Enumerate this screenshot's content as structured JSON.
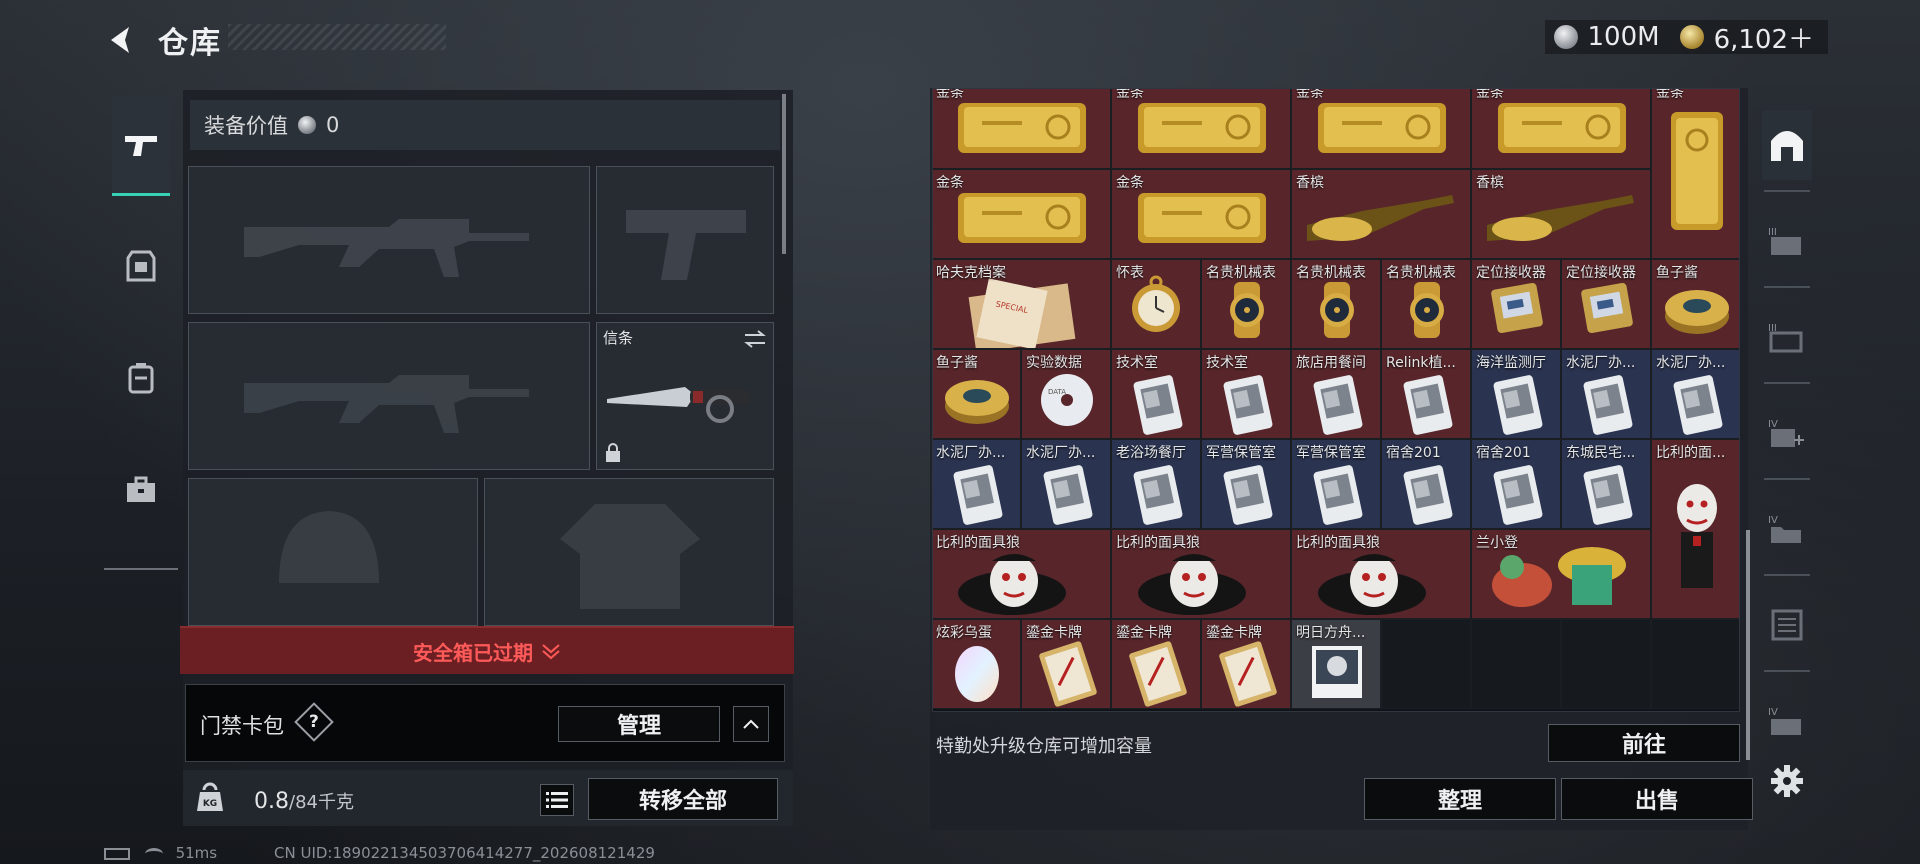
{
  "header": {
    "title": "仓库",
    "back_icon": "back-arrow-icon"
  },
  "currency": [
    {
      "icon": "silver-coin-icon",
      "value": "100M"
    },
    {
      "icon": "gold-coin-icon",
      "value": "6,102＋"
    }
  ],
  "left_nav": [
    {
      "name": "weapon",
      "icon": "pistol-icon",
      "active": true
    },
    {
      "name": "armor",
      "icon": "armor-icon"
    },
    {
      "name": "backpack",
      "icon": "backpack-icon"
    },
    {
      "name": "case",
      "icon": "briefcase-icon"
    }
  ],
  "equipment": {
    "value_label": "装备价值",
    "value": "0",
    "knife_slot_label": "信条",
    "slots": [
      "primary-rifle",
      "pistol",
      "secondary-rifle",
      "melee",
      "helmet",
      "armor-vest"
    ]
  },
  "safe_box": {
    "status": "安全箱已过期"
  },
  "card_pack": {
    "label": "门禁卡包",
    "help": "?",
    "manage": "管理"
  },
  "weight": {
    "current": "0.8",
    "max": "/84千克"
  },
  "transfer_all": "转移全部",
  "stash_items": [
    {
      "label": "金条",
      "color": "red",
      "type": "gold-bar"
    },
    {
      "label": "金条",
      "color": "red",
      "type": "gold-bar"
    },
    {
      "label": "金条",
      "color": "red",
      "type": "gold-bar"
    },
    {
      "label": "金条",
      "color": "red",
      "type": "gold-bar"
    },
    {
      "label": "金条",
      "color": "red",
      "type": "gold-bar-vertical"
    },
    {
      "label": "金条",
      "color": "red",
      "type": "gold-bar"
    },
    {
      "label": "金条",
      "color": "red",
      "type": "gold-bar"
    },
    {
      "label": "香槟",
      "color": "red",
      "type": "champagne"
    },
    {
      "label": "香槟",
      "color": "red",
      "type": "champagne"
    },
    {
      "label": "哈夫克档案",
      "color": "red",
      "type": "dossier"
    },
    {
      "label": "怀表",
      "color": "red",
      "type": "pocket-watch"
    },
    {
      "label": "名贵机械表",
      "color": "red",
      "type": "wristwatch"
    },
    {
      "label": "名贵机械表",
      "color": "red",
      "type": "wristwatch"
    },
    {
      "label": "名贵机械表",
      "color": "red",
      "type": "wristwatch"
    },
    {
      "label": "定位接收器",
      "color": "red",
      "type": "receiver"
    },
    {
      "label": "定位接收器",
      "color": "red",
      "type": "receiver"
    },
    {
      "label": "鱼子酱",
      "color": "red",
      "type": "caviar"
    },
    {
      "label": "鱼子酱",
      "color": "red",
      "type": "caviar"
    },
    {
      "label": "实验数据",
      "color": "red",
      "type": "disc"
    },
    {
      "label": "技术室",
      "color": "red",
      "type": "keycard"
    },
    {
      "label": "技术室",
      "color": "red",
      "type": "keycard"
    },
    {
      "label": "旅店用餐间",
      "color": "red",
      "type": "keycard"
    },
    {
      "label": "Relink植...",
      "color": "red",
      "type": "keycard"
    },
    {
      "label": "海洋监测厅",
      "color": "blue",
      "type": "keycard"
    },
    {
      "label": "水泥厂办...",
      "color": "blue",
      "type": "keycard"
    },
    {
      "label": "水泥厂办...",
      "color": "blue",
      "type": "keycard"
    },
    {
      "label": "水泥厂办...",
      "color": "blue",
      "type": "keycard"
    },
    {
      "label": "水泥厂办...",
      "color": "blue",
      "type": "keycard"
    },
    {
      "label": "老浴场餐厅",
      "color": "blue",
      "type": "keycard"
    },
    {
      "label": "军营保管室",
      "color": "blue",
      "type": "keycard"
    },
    {
      "label": "军营保管室",
      "color": "blue",
      "type": "keycard"
    },
    {
      "label": "宿舍201",
      "color": "blue",
      "type": "keycard"
    },
    {
      "label": "宿舍201",
      "color": "blue",
      "type": "keycard"
    },
    {
      "label": "东城民宅...",
      "color": "blue",
      "type": "keycard"
    },
    {
      "label": "比利的面...",
      "color": "red",
      "type": "puppet-tall"
    },
    {
      "label": "比利的面具狼",
      "color": "red",
      "type": "puppet"
    },
    {
      "label": "比利的面具狼",
      "color": "red",
      "type": "puppet"
    },
    {
      "label": "比利的面具狼",
      "color": "red",
      "type": "puppet"
    },
    {
      "label": "兰小登",
      "color": "red",
      "type": "figure"
    },
    {
      "label": "炫彩乌蛋",
      "color": "red",
      "type": "egg"
    },
    {
      "label": "鎏金卡牌",
      "color": "red",
      "type": "card"
    },
    {
      "label": "鎏金卡牌",
      "color": "red",
      "type": "card"
    },
    {
      "label": "鎏金卡牌",
      "color": "red",
      "type": "card"
    },
    {
      "label": "明日方舟...",
      "color": "gray",
      "type": "album"
    }
  ],
  "capacity_hint": "特勤处升级仓库可增加容量",
  "go_button": "前往",
  "sort_button": "整理",
  "sell_button": "出售",
  "right_nav": [
    "home-icon",
    "storage-III-a-icon",
    "storage-III-b-icon",
    "storage-IV-add-icon",
    "storage-IV-folder-icon",
    "storage-list-icon",
    "storage-IV-c-icon",
    "settings-gear-icon"
  ],
  "status": {
    "ping": "51ms",
    "uid": "CN UID:189022134503706414277_202608121429"
  },
  "colors": {
    "accent_teal": "#36d3b7",
    "red_tier": "#58262a",
    "blue_tier": "#2a3350",
    "gold": "#d4a93a",
    "warning_red": "#ff5a5a"
  }
}
